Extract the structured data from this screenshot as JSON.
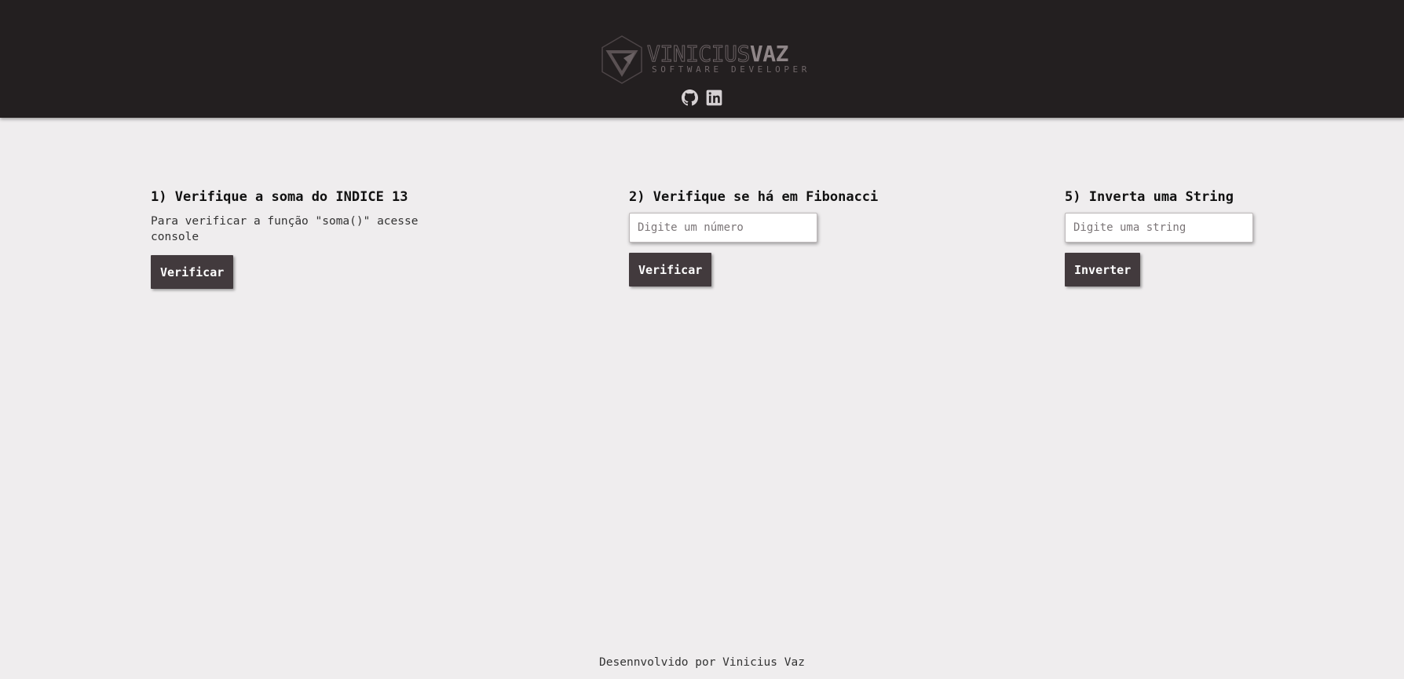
{
  "header": {
    "logo": {
      "first_name": "VINICIUS",
      "last_name": "VAZ",
      "subtitle": "SOFTWARE DEVELOPER"
    },
    "social": [
      {
        "icon": "github-icon"
      },
      {
        "icon": "linkedin-icon"
      }
    ]
  },
  "sections": [
    {
      "title": "1) Verifique a soma do INDICE 13",
      "description": "Para verificar a função \"soma()\" acesse console",
      "button": "Verificar"
    },
    {
      "title": "2) Verifique se há em Fibonacci",
      "input_placeholder": "Digite um número",
      "input_value": "",
      "button": "Verificar"
    },
    {
      "title": "5) Inverta uma String",
      "input_placeholder": "Digite uma string",
      "input_value": "",
      "button": "Inverter"
    }
  ],
  "footer": {
    "text": "Desennvolvido por Vinicius Vaz"
  },
  "colors": {
    "header_bg": "#231f20",
    "page_bg": "#efedee",
    "button_bg": "#423a3d"
  }
}
